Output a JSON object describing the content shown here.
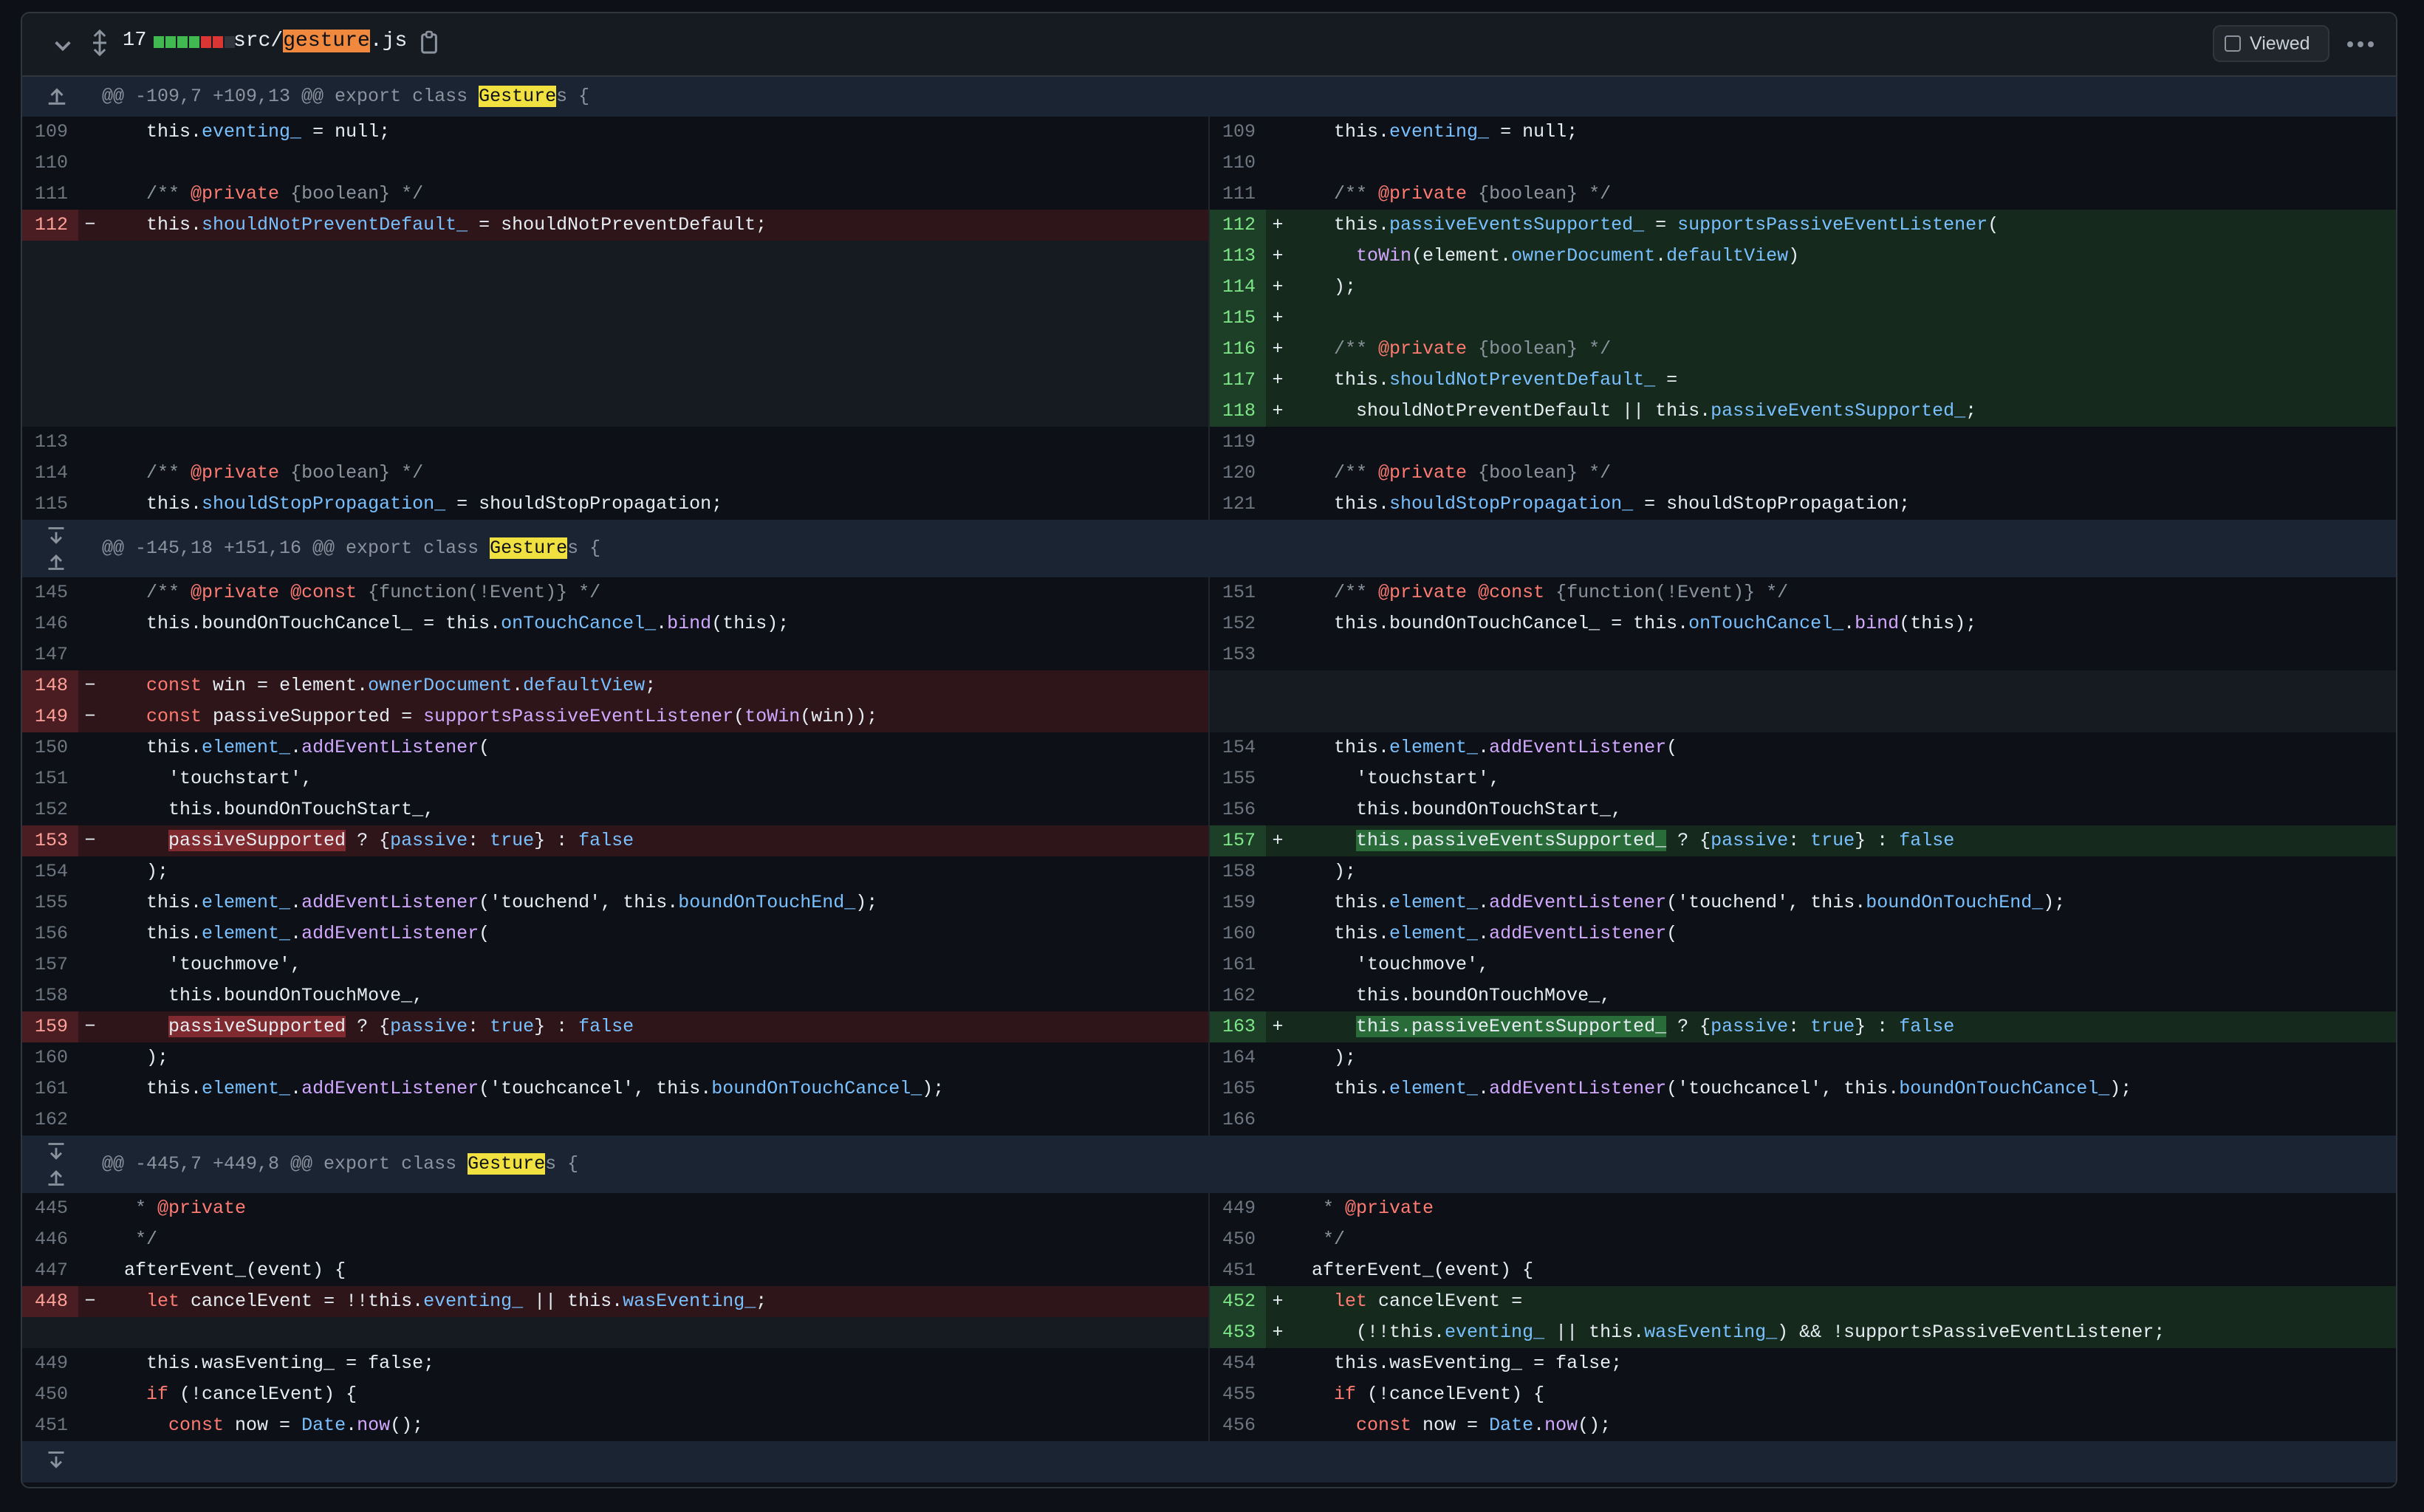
{
  "header": {
    "changed_count": "17",
    "diffstat": [
      "#3fb950",
      "#3fb950",
      "#3fb950",
      "#3fb950",
      "#da3633",
      "#da3633",
      "#30363d"
    ],
    "path_prefix": "src/",
    "path_match": "gesture",
    "path_suffix": ".js",
    "viewed_label": "Viewed"
  },
  "hunks": [
    {
      "pre": "@@ -109,7 +109,13 @@ export class ",
      "match": "Gesture",
      "post": "s {"
    },
    {
      "pre": "@@ -145,18 +151,16 @@ export class ",
      "match": "Gesture",
      "post": "s {"
    },
    {
      "pre": "@@ -445,7 +449,8 @@ export class ",
      "match": "Gesture",
      "post": "s {"
    }
  ],
  "lines": {
    "l109": "109",
    "l110": "110",
    "l111": "111",
    "l112": "112",
    "l113": "113",
    "l114": "114",
    "l115": "115",
    "r109": "109",
    "r110": "110",
    "r111": "111",
    "r112": "112",
    "r113": "113",
    "r114": "114",
    "r115": "115",
    "r116": "116",
    "r117": "117",
    "r118": "118",
    "r119": "119",
    "r120": "120",
    "r121": "121",
    "l145": "145",
    "l146": "146",
    "l147": "147",
    "l148": "148",
    "l149": "149",
    "l150": "150",
    "l151": "151",
    "l152": "152",
    "l153": "153",
    "l154": "154",
    "l155": "155",
    "l156": "156",
    "l157": "157",
    "l158": "158",
    "l159": "159",
    "l160": "160",
    "l161": "161",
    "l162": "162",
    "r151": "151",
    "r152": "152",
    "r153": "153",
    "r154": "154",
    "r155": "155",
    "r156": "156",
    "r157": "157",
    "r158": "158",
    "r159": "159",
    "r160": "160",
    "r161": "161",
    "r162": "162",
    "r163": "163",
    "r164": "164",
    "r165": "165",
    "r166": "166",
    "l445": "445",
    "l446": "446",
    "l447": "447",
    "l448": "448",
    "l449": "449",
    "l450": "450",
    "l451": "451",
    "r449": "449",
    "r450": "450",
    "r451": "451",
    "r452": "452",
    "r453": "453",
    "r454": "454",
    "r455": "455",
    "r456": "456"
  },
  "markers": {
    "minus": "−",
    "plus": "+"
  },
  "code": {
    "this": "this.",
    "eventing": "eventing_",
    "eq_null": " = null;",
    "c_open": "/** ",
    "private": "@private",
    "bool": " {boolean}",
    "c_close": " */",
    "sNPD": "shouldNotPreventDefault_",
    "eq": " = ",
    "sNPD_val": "shouldNotPreventDefault;",
    "pES": "passiveEventsSupported_",
    "sPEL": "supportsPassiveEventListener",
    "paren_open": "(",
    "toWin": "toWin",
    "element": "element.",
    "ownerDoc": "ownerDocument",
    "dot": ".",
    "defView": "defaultView",
    "close_paren": ")",
    "close_semi": ");",
    "sNPD2": "shouldNotPreventDefault_",
    "eq_end": " =",
    "or": " || ",
    "semi": ";",
    "sNPD_plain": "shouldNotPreventDefault",
    "sSP": "shouldStopPropagation_",
    "sSP_val": "shouldStopPropagation;",
    "const": "@const",
    "fn_type": " {function(!Event)}",
    "bOTC": "boundOnTouchCancel_",
    "onTC": "onTouchCancel_",
    "bind": "bind",
    "this_arg": "(this);",
    "const_kw": "const",
    "win_eq": " win = ",
    "passSup_eq": " passiveSupported = ",
    "win_arg": "(win));",
    "element_": "element_",
    "addEL": "addEventListener",
    "touchstart": "'touchstart',",
    "bOTS": "boundOnTouchStart_",
    "comma": ",",
    "passSup": "passiveSupported",
    "tern_a": " ? {",
    "passive": "passive",
    "colon": ": ",
    "true_kw": "true",
    "tern_b": "} : ",
    "false_kw": "false",
    "touchend": "'touchend'",
    "comma_sp": ", ",
    "bOTE": "boundOnTouchEnd_",
    "touchmove": "'touchmove',",
    "bOTM": "boundOnTouchMove_",
    "touchcancel": "'touchcancel'",
    "this_pES": "this.passiveEventsSupported_",
    "star": "* ",
    "star_close": "*/",
    "afterEvent": "afterEvent_",
    "event_arg": "(event) {",
    "let_kw": "let",
    "cancelEvent_eq": " cancelEvent = ",
    "notnot": "!!",
    "wasEventing": "wasEventing_",
    "cancelEvent_eq2": " cancelEvent =",
    "paren_nn": "(!!",
    "and_not": ") && !",
    "wE_false": " = false;",
    "if_kw": "if",
    "not_cancel": " (!cancelEvent) {",
    "now_eq": " now = ",
    "Date": "Date",
    "now_call": "now",
    "call_end": "();"
  },
  "colors": {
    "add": "#3fb950",
    "del": "#f85149",
    "hunk_bg": "#1b2433"
  }
}
